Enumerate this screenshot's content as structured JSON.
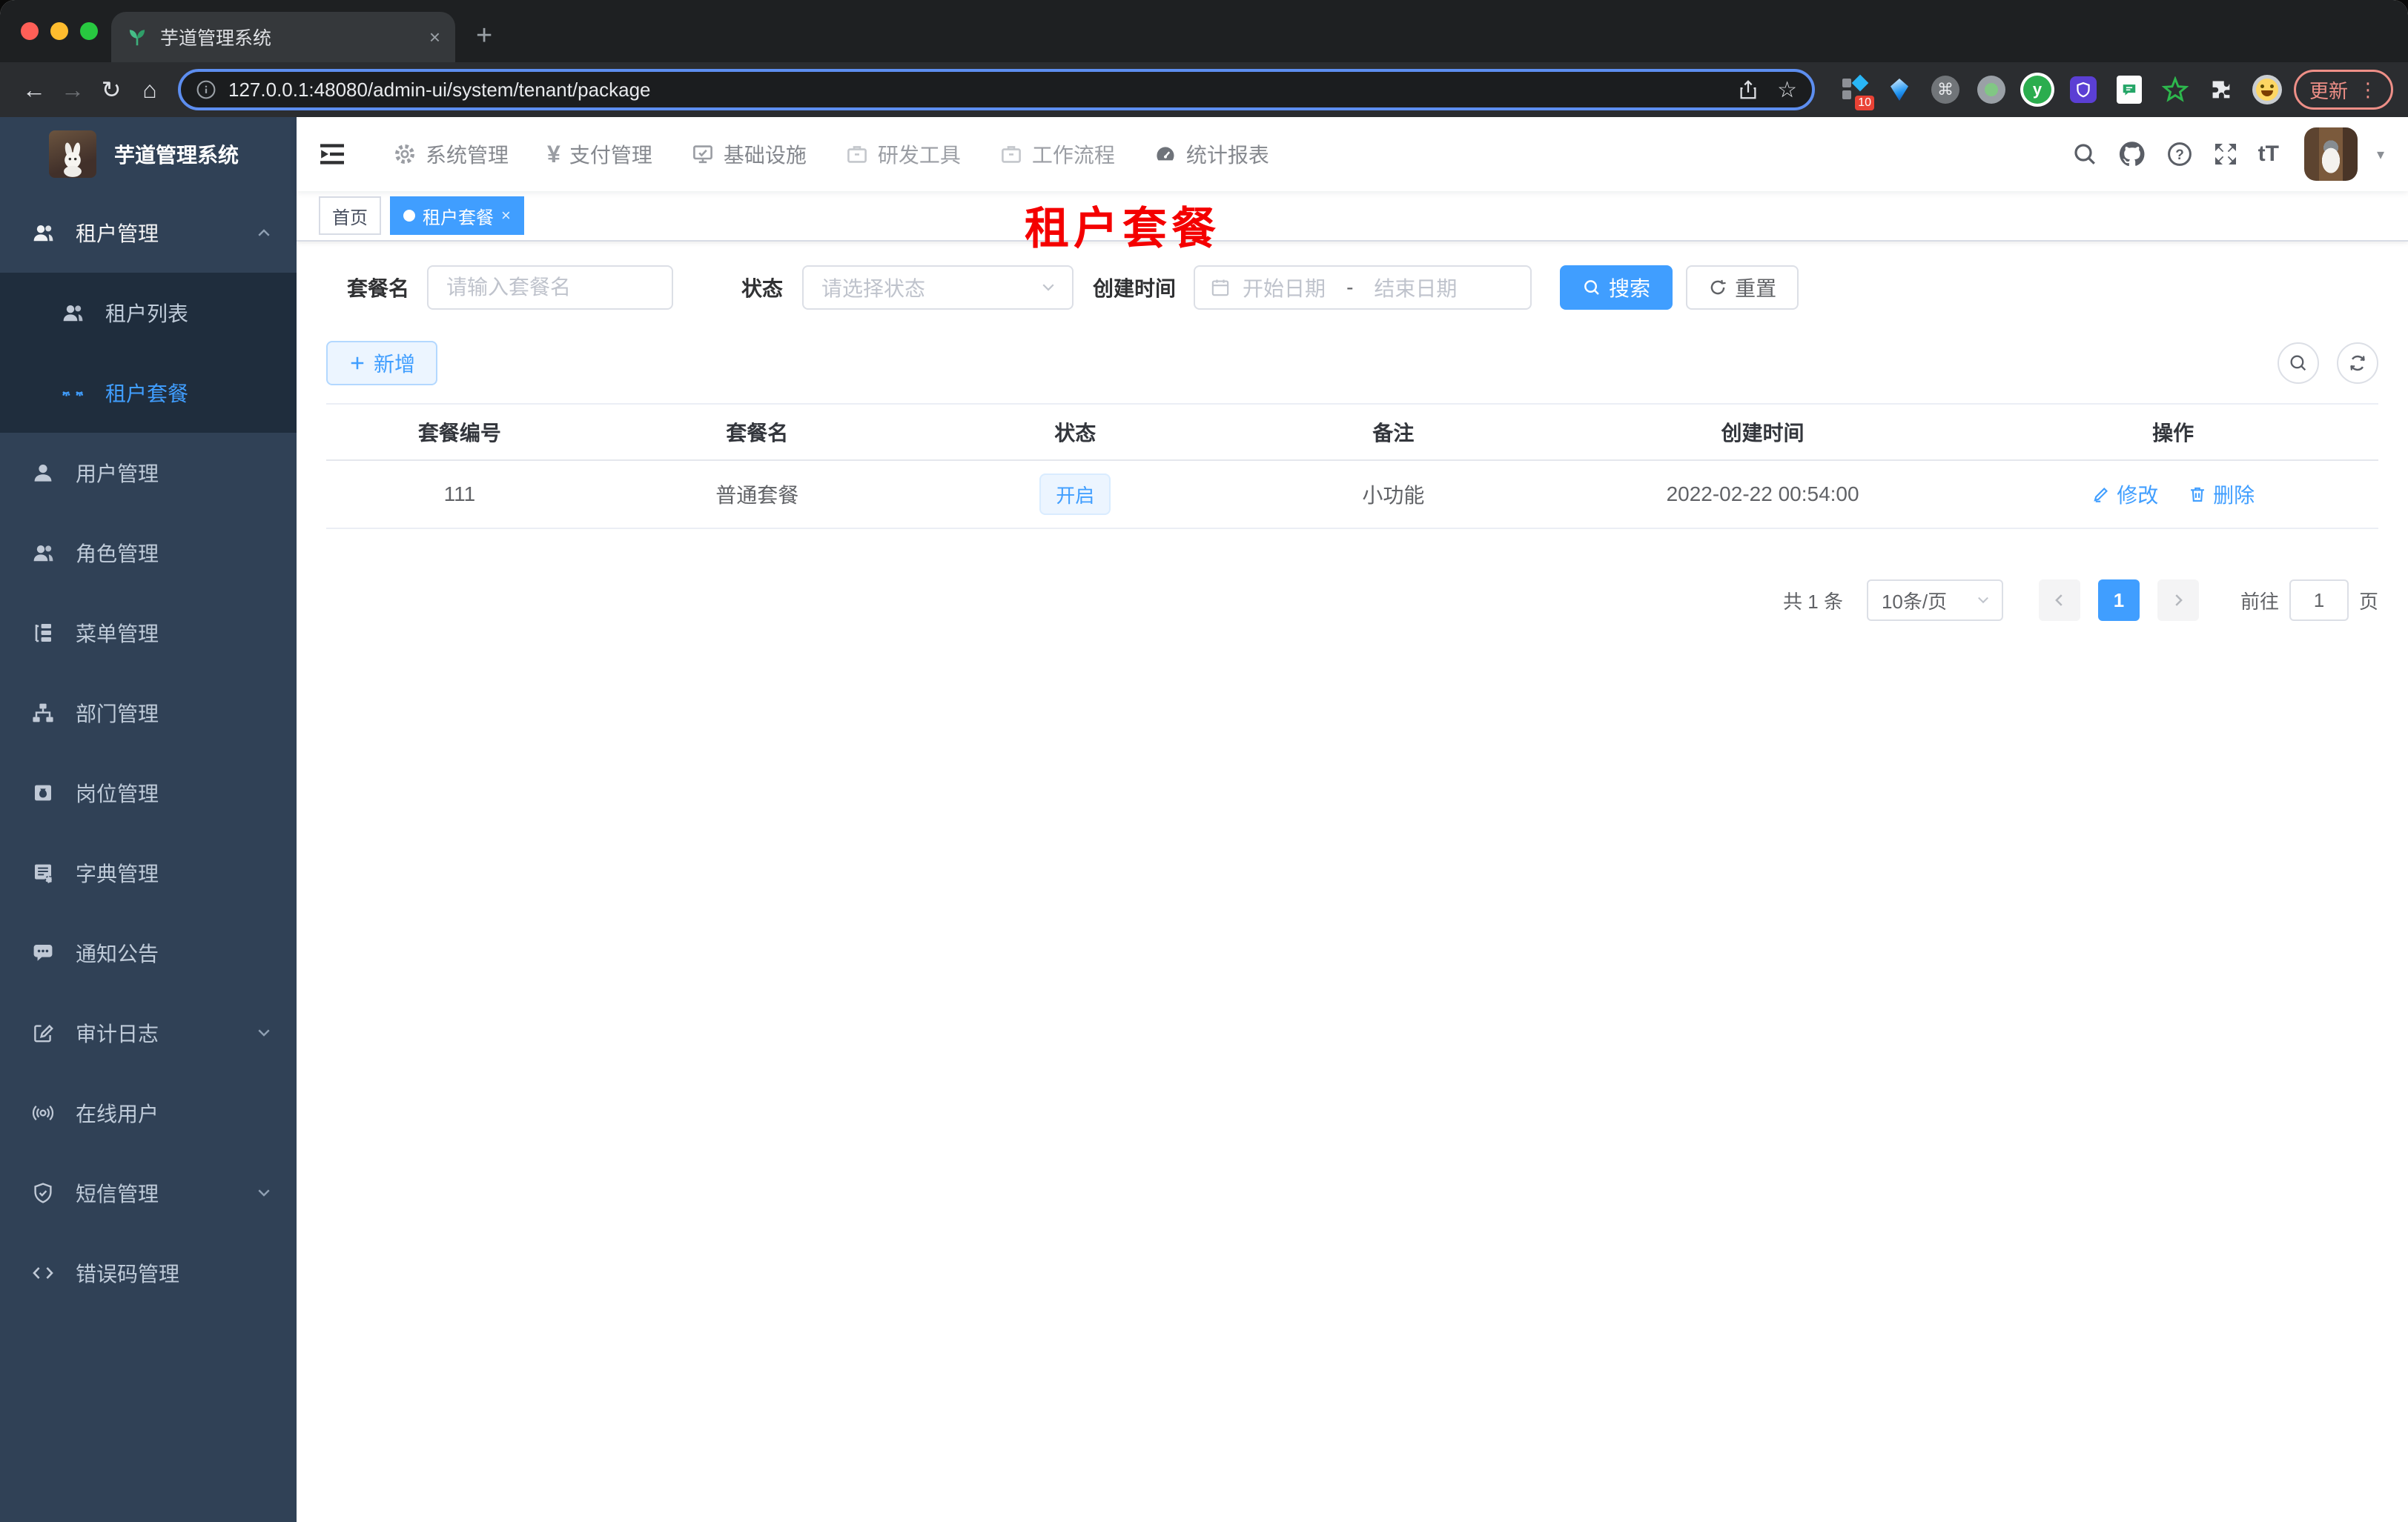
{
  "browser": {
    "tab_title": "芋道管理系统",
    "url": "127.0.0.1:48080/admin-ui/system/tenant/package",
    "extension_badge": "10",
    "extension_y": "y",
    "update_label": "更新"
  },
  "icons": {
    "close": "×",
    "plus": "+",
    "back": "←",
    "forward": "→",
    "reload": "↻",
    "home": "⌂",
    "star": "☆",
    "kebab": "⋮",
    "caret": "▾",
    "cmd": "⌘",
    "yen": "¥",
    "font_size": "tT"
  },
  "app": {
    "logo_title": "芋道管理系统",
    "top_nav": {
      "items": [
        {
          "label": "系统管理"
        },
        {
          "label": "支付管理"
        },
        {
          "label": "基础设施"
        },
        {
          "label": "研发工具"
        },
        {
          "label": "工作流程"
        },
        {
          "label": "统计报表"
        }
      ]
    },
    "sidebar": {
      "items": [
        {
          "label": "租户管理"
        },
        {
          "label": "租户列表"
        },
        {
          "label": "租户套餐"
        },
        {
          "label": "用户管理"
        },
        {
          "label": "角色管理"
        },
        {
          "label": "菜单管理"
        },
        {
          "label": "部门管理"
        },
        {
          "label": "岗位管理"
        },
        {
          "label": "字典管理"
        },
        {
          "label": "通知公告"
        },
        {
          "label": "审计日志"
        },
        {
          "label": "在线用户"
        },
        {
          "label": "短信管理"
        },
        {
          "label": "错误码管理"
        }
      ]
    },
    "tags": {
      "home": "首页",
      "active": "租户套餐"
    },
    "annotation": "租户套餐",
    "filter": {
      "name_label": "套餐名",
      "name_placeholder": "请输入套餐名",
      "status_label": "状态",
      "status_placeholder": "请选择状态",
      "created_label": "创建时间",
      "date_start_placeholder": "开始日期",
      "date_separator": "-",
      "date_end_placeholder": "结束日期",
      "search_label": "搜索",
      "reset_label": "重置"
    },
    "toolbar": {
      "add_label": "新增"
    },
    "table": {
      "headers": [
        "套餐编号",
        "套餐名",
        "状态",
        "备注",
        "创建时间",
        "操作"
      ],
      "rows": [
        {
          "id": "111",
          "name": "普通套餐",
          "status": "开启",
          "remark": "小功能",
          "created_at": "2022-02-22 00:54:00",
          "edit_label": "修改",
          "delete_label": "删除"
        }
      ]
    },
    "pagination": {
      "total": "共 1 条",
      "page_size": "10条/页",
      "current_page": "1",
      "goto_label": "前往",
      "goto_value": "1",
      "unit_label": "页"
    }
  },
  "colors": {
    "accent": "#409eff",
    "sidebar_bg": "#304156",
    "submenu_bg": "#1f2d3d",
    "annotation_red": "#f40000",
    "status_tag_bg": "#ecf5ff"
  }
}
